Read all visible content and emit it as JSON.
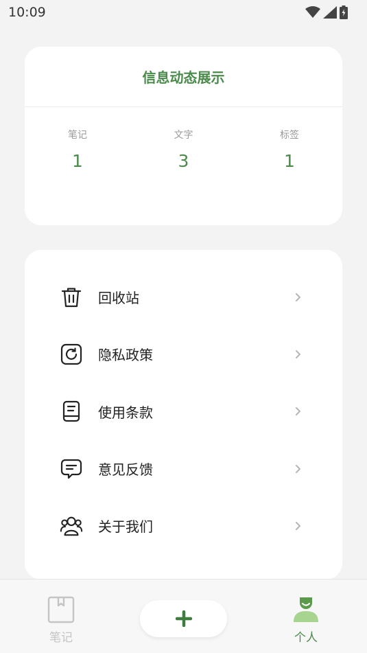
{
  "status_bar": {
    "time": "10:09"
  },
  "stats": {
    "title": "信息动态展示",
    "items": [
      {
        "label": "笔记",
        "value": "1"
      },
      {
        "label": "文字",
        "value": "3"
      },
      {
        "label": "标签",
        "value": "1"
      }
    ]
  },
  "menu": {
    "items": [
      {
        "label": "回收站",
        "icon": "trash-icon"
      },
      {
        "label": "隐私政策",
        "icon": "privacy-icon"
      },
      {
        "label": "使用条款",
        "icon": "document-icon"
      },
      {
        "label": "意见反馈",
        "icon": "feedback-icon"
      },
      {
        "label": "关于我们",
        "icon": "group-icon"
      }
    ]
  },
  "bottom_nav": {
    "notes_label": "笔记",
    "me_label": "个人",
    "active": "个人"
  },
  "colors": {
    "accent": "#4a8a4a",
    "inactive": "#c4c4c4",
    "background": "#f3f3f3"
  }
}
